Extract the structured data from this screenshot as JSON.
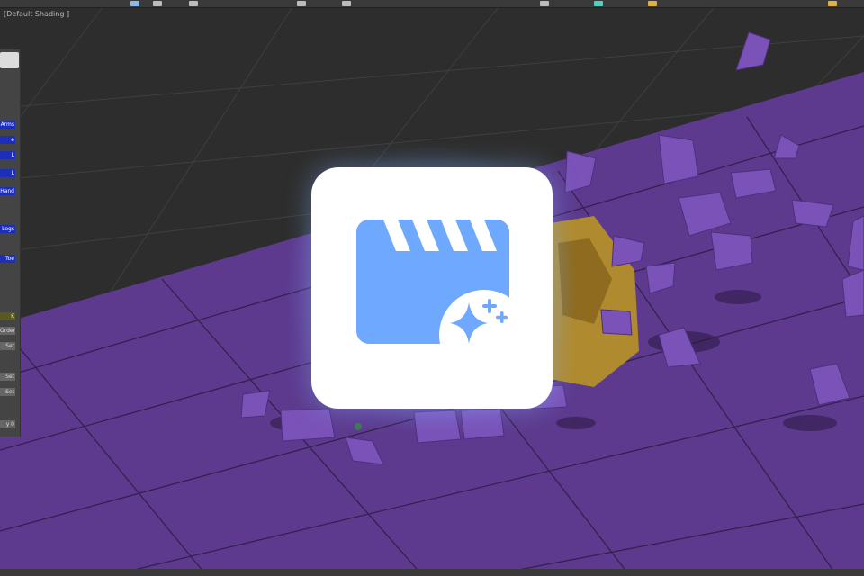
{
  "viewport": {
    "label": "[Default Shading ]"
  },
  "left_panel": {
    "buttons": [
      "Arms",
      "e",
      "L",
      "L",
      "Hand",
      "Legs",
      "Toe"
    ],
    "controls": [
      "K",
      "Order",
      "Set",
      "Set",
      "Set",
      "y 0"
    ]
  },
  "app_icon": {
    "name": "video-ai-enhance-icon",
    "icon": "clapperboard-sparkle-icon"
  },
  "colors": {
    "floor": "#5d3a8e",
    "debris": "#7a52b8",
    "creature": "#b08a2e",
    "icon_blue": "#6fa8ff",
    "icon_bg": "#ffffff"
  }
}
